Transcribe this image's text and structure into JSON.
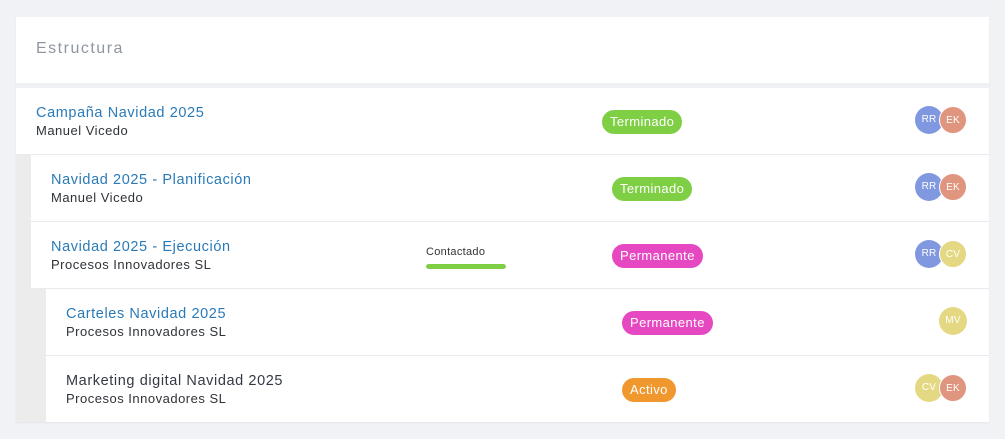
{
  "panel": {
    "title": "Estructura"
  },
  "colors": {
    "link": "#2a7ab8",
    "terminado": "#7fcf45",
    "permanente": "#e548c0",
    "activo": "#f0972d",
    "avatar_rr": "#8098e0",
    "avatar_ek": "#e0957e",
    "avatar_cv": "#e4d982",
    "avatar_mv": "#e4d982"
  },
  "rows": [
    {
      "title": "Campaña Navidad 2025",
      "subtitle": "Manuel Vicedo",
      "status": "Terminado",
      "avatars": [
        "RR",
        "EK"
      ]
    },
    {
      "title": "Navidad 2025 - Planificación",
      "subtitle": "Manuel Vicedo",
      "status": "Terminado",
      "avatars": [
        "RR",
        "EK"
      ]
    },
    {
      "title": "Navidad 2025 - Ejecución",
      "subtitle": "Procesos Innovadores SL",
      "progress_label": "Contactado",
      "progress": 1.0,
      "status": "Permanente",
      "avatars": [
        "RR",
        "CV"
      ]
    },
    {
      "title": "Carteles Navidad 2025",
      "subtitle": "Procesos Innovadores SL",
      "status": "Permanente",
      "avatars": [
        "MV"
      ]
    },
    {
      "title": "Marketing digital Navidad 2025",
      "subtitle": "Procesos Innovadores SL",
      "status": "Activo",
      "avatars": [
        "CV",
        "EK"
      ]
    }
  ]
}
